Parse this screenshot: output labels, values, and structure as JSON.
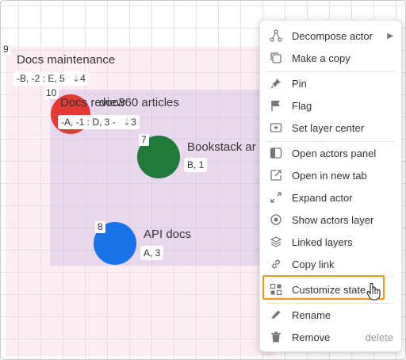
{
  "canvas": {
    "outer_layer": {
      "number": "9",
      "title": "Docs maintenance",
      "tag": "-B, -2 : E, 5",
      "tag_count": "4"
    },
    "inner_layer": {
      "number": "10",
      "title_back": "Docs review",
      "title_front": "doc360 articles",
      "tag": "-A, -1 : D, 3 -",
      "tag_count": "3"
    },
    "actor_bookstack": {
      "number": "7",
      "title": "Bookstack ar",
      "tag": "B, 1",
      "color": "#1e7b3b"
    },
    "actor_api": {
      "number": "8",
      "title": "API docs",
      "tag": "A, 3",
      "color": "#1a73e8"
    },
    "actor_red": {
      "color": "#e53935"
    }
  },
  "menu": {
    "items": [
      {
        "label": "Decompose actor",
        "icon": "decompose-icon",
        "submenu": true
      },
      {
        "label": "Make a copy",
        "icon": "copy-icon"
      },
      {
        "label": "Pin",
        "icon": "pin-icon"
      },
      {
        "label": "Flag",
        "icon": "flag-icon"
      },
      {
        "label": "Set layer center",
        "icon": "layer-center-icon"
      },
      {
        "label": "Open actors panel",
        "icon": "panel-icon"
      },
      {
        "label": "Open in new tab",
        "icon": "new-tab-icon"
      },
      {
        "label": "Expand actor",
        "icon": "expand-icon"
      },
      {
        "label": "Show actors layer",
        "icon": "show-layer-icon"
      },
      {
        "label": "Linked layers",
        "icon": "linked-layers-icon"
      },
      {
        "label": "Copy link",
        "icon": "link-icon"
      },
      {
        "label": "Customize state",
        "icon": "customize-icon",
        "highlighted": true
      },
      {
        "label": "Rename",
        "icon": "pencil-icon"
      },
      {
        "label": "Remove",
        "icon": "trash-icon",
        "shortcut": "delete"
      }
    ],
    "highlight_color": "#f39a1c"
  }
}
